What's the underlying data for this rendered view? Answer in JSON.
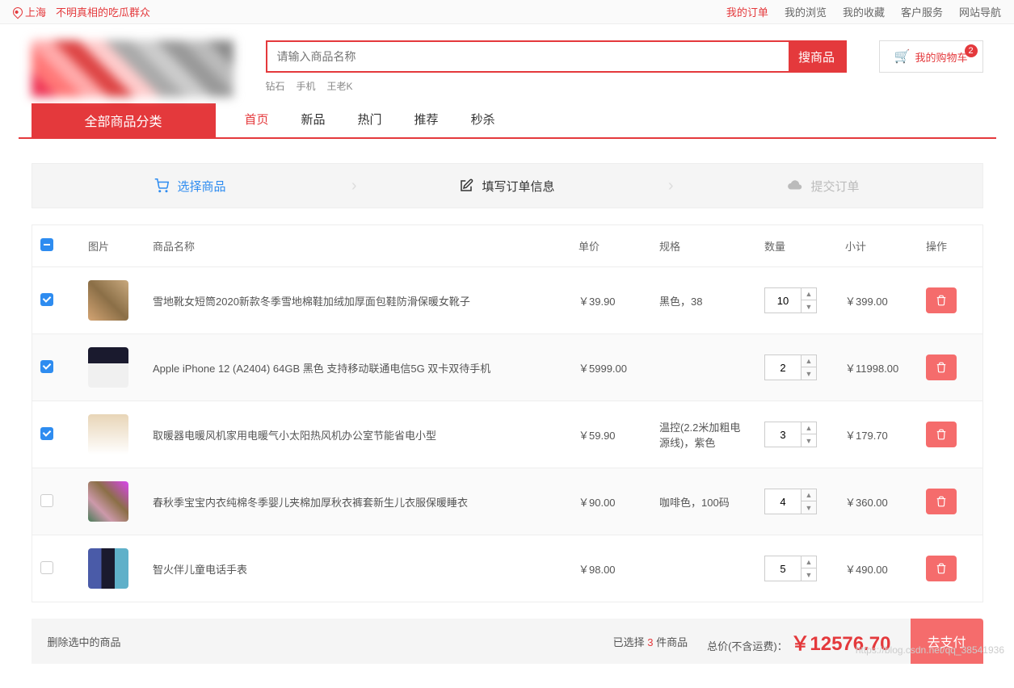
{
  "topbar": {
    "location": "上海",
    "user_label": "不明真相的吃瓜群众",
    "links": [
      "我的订单",
      "我的浏览",
      "我的收藏",
      "客户服务",
      "网站导航"
    ],
    "active_link": 0
  },
  "search": {
    "placeholder": "请输入商品名称",
    "button": "搜商品",
    "hot_words": [
      "钻石",
      "手机",
      "王老K"
    ]
  },
  "cart_button": {
    "label": "我的购物车",
    "badge": "2"
  },
  "category_button": "全部商品分类",
  "nav": {
    "items": [
      "首页",
      "新品",
      "热门",
      "推荐",
      "秒杀"
    ],
    "active": 0
  },
  "steps": {
    "s1": "选择商品",
    "s2": "填写订单信息",
    "s3": "提交订单"
  },
  "table": {
    "headers": {
      "img": "图片",
      "name": "商品名称",
      "price": "单价",
      "spec": "规格",
      "qty": "数量",
      "sub": "小计",
      "act": "操作"
    },
    "rows": [
      {
        "checked": true,
        "img": "p1",
        "name": "雪地靴女短筒2020新款冬季雪地棉鞋加绒加厚面包鞋防滑保暖女靴子",
        "price": "￥39.90",
        "spec": "黑色，38",
        "qty": "10",
        "sub": "￥399.00"
      },
      {
        "checked": true,
        "img": "p2",
        "name": "Apple iPhone 12 (A2404) 64GB 黑色 支持移动联通电信5G 双卡双待手机",
        "price": "￥5999.00",
        "spec": "",
        "qty": "2",
        "sub": "￥11998.00"
      },
      {
        "checked": true,
        "img": "p3",
        "name": "取暖器电暖风机家用电暖气小太阳热风机办公室节能省电小型",
        "price": "￥59.90",
        "spec": "温控(2.2米加粗电源线)，紫色",
        "qty": "3",
        "sub": "￥179.70"
      },
      {
        "checked": false,
        "img": "p4",
        "name": "春秋季宝宝内衣纯棉冬季婴儿夹棉加厚秋衣裤套新生儿衣服保暖睡衣",
        "price": "￥90.00",
        "spec": "咖啡色，100码",
        "qty": "4",
        "sub": "￥360.00"
      },
      {
        "checked": false,
        "img": "p5",
        "name": "智火伴儿童电话手表",
        "price": "￥98.00",
        "spec": "",
        "qty": "5",
        "sub": "￥490.00"
      }
    ]
  },
  "footer": {
    "delete_selected": "删除选中的商品",
    "selected_prefix": "已选择 ",
    "selected_count": "3",
    "selected_suffix": " 件商品",
    "total_label": "总价(不含运费)：",
    "total_price": "￥12576.70",
    "checkout": "去支付"
  },
  "watermark": "https://blog.csdn.net/qq_38541936"
}
